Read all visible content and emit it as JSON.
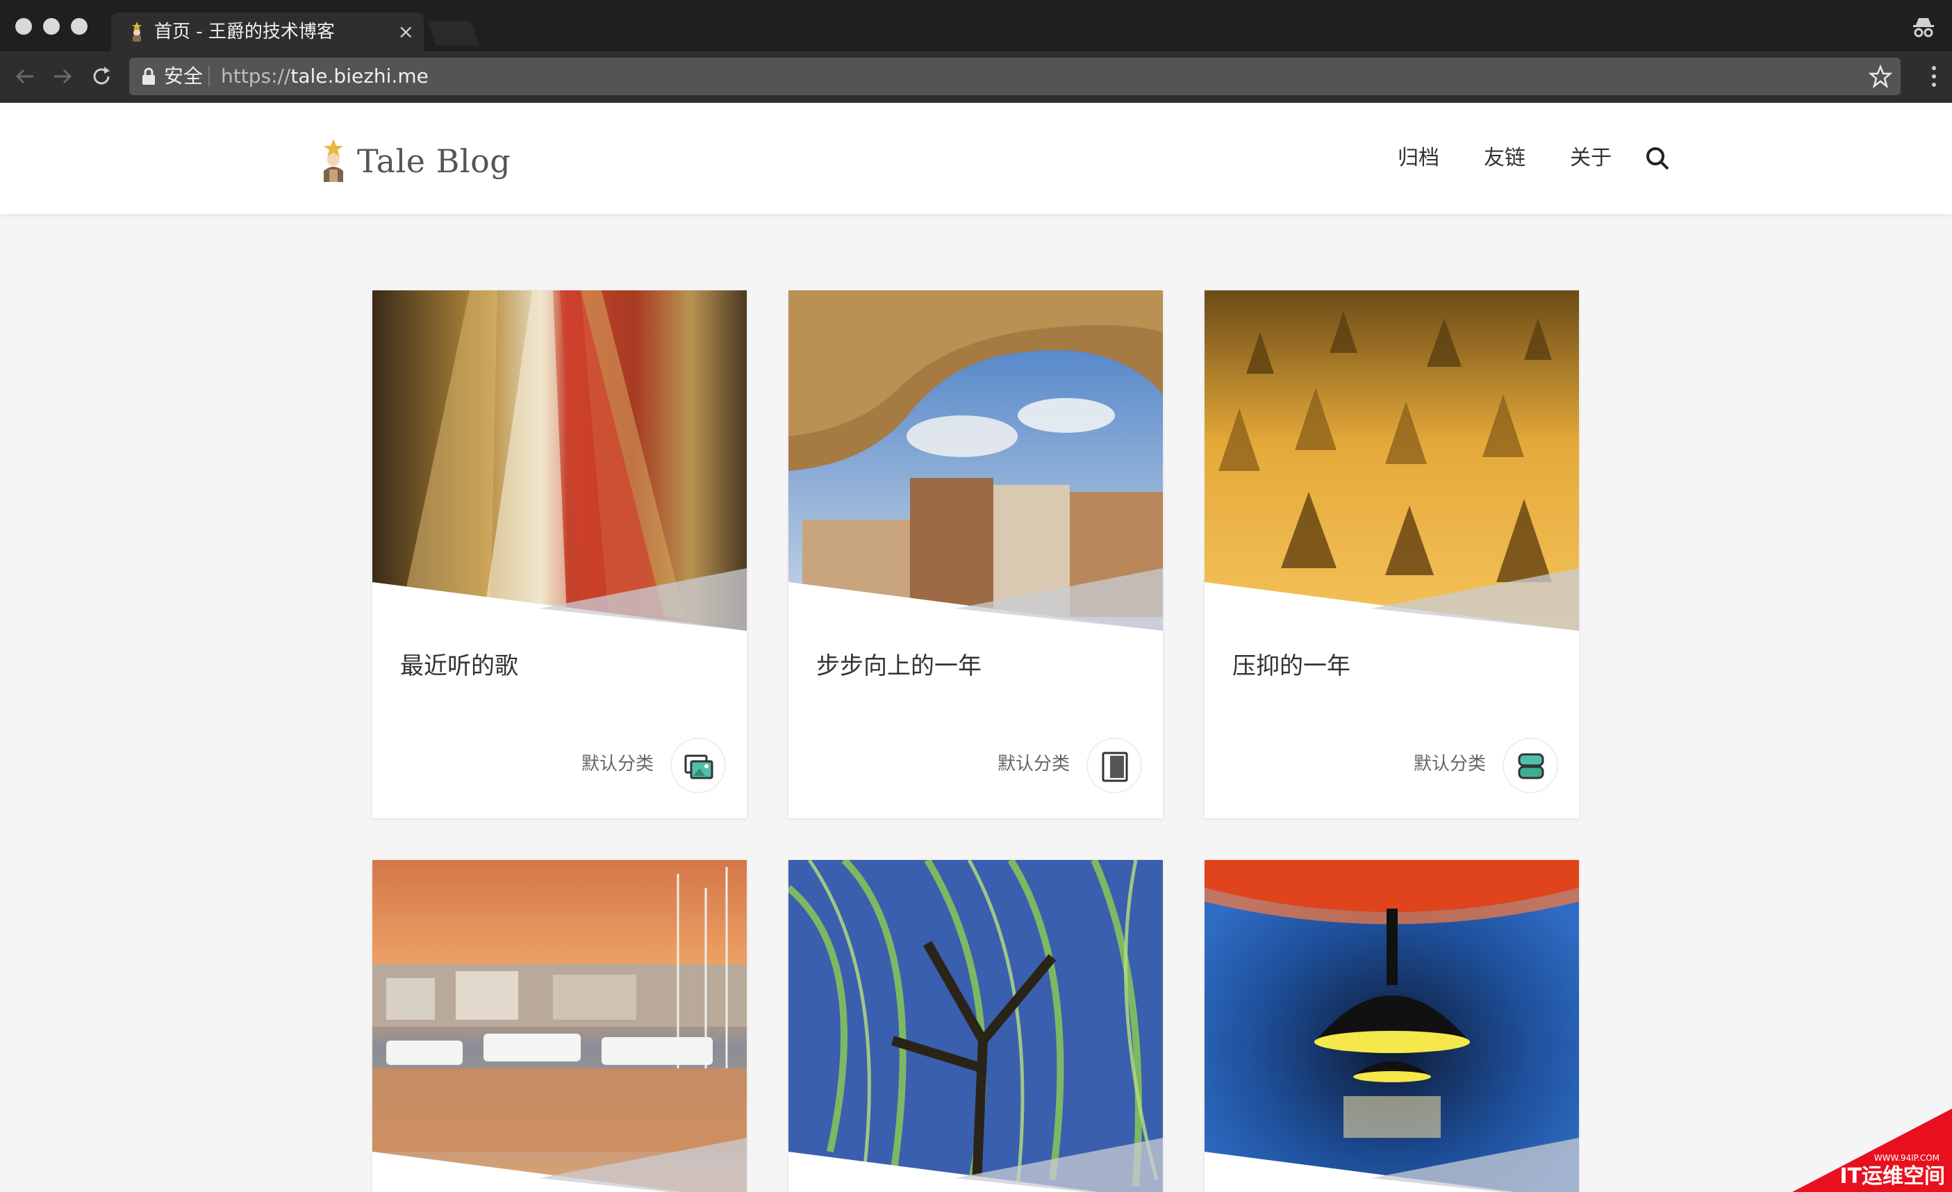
{
  "browser": {
    "tab_title": "首页 - 王爵的技术博客",
    "tab_close": "×",
    "secure_label": "安全",
    "url_scheme": "https://",
    "url_host": "tale.biezhi.me"
  },
  "site": {
    "logo_text": "Tale Blog",
    "nav": {
      "archive": "归档",
      "links": "友链",
      "about": "关于"
    }
  },
  "cards": [
    {
      "title": "最近听的歌",
      "category": "默认分类",
      "category_icon": "gallery-icon"
    },
    {
      "title": "步步向上的一年",
      "category": "默认分类",
      "category_icon": "book-icon"
    },
    {
      "title": "压抑的一年",
      "category": "默认分类",
      "category_icon": "chat-icon"
    },
    {
      "title": "",
      "category": "",
      "category_icon": ""
    },
    {
      "title": "",
      "category": "",
      "category_icon": ""
    },
    {
      "title": "",
      "category": "",
      "category_icon": ""
    }
  ],
  "watermark": {
    "small": "WWW.94IP.COM",
    "large": "IT运维空间"
  }
}
